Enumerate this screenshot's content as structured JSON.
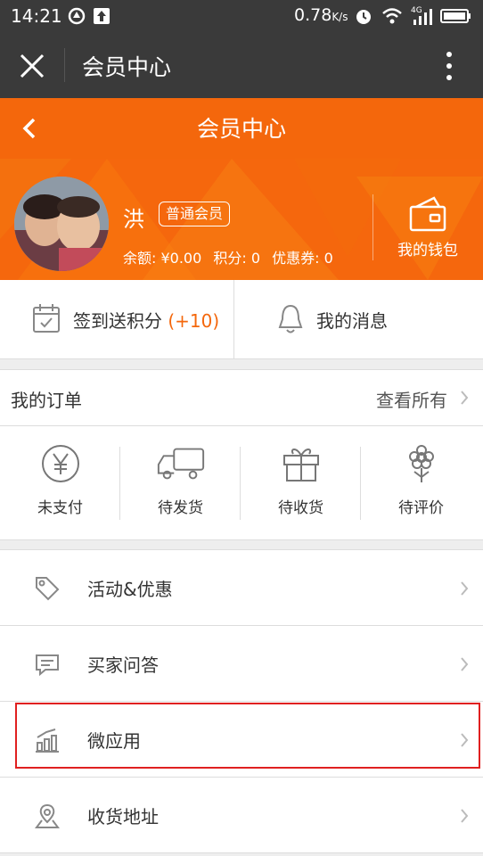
{
  "statusbar": {
    "time": "14:21",
    "speed": "0.78",
    "speed_unit": "K/s",
    "network": "4G"
  },
  "wechat": {
    "title": "会员中心"
  },
  "header": {
    "title": "会员中心"
  },
  "profile": {
    "name": "洪",
    "badge": "普通会员",
    "balance": "余额: ¥0.00",
    "points": "积分: 0",
    "coupons": "优惠券: 0",
    "wallet_label": "我的钱包"
  },
  "checkin": {
    "label": "签到送积分",
    "bonus": "(+10)"
  },
  "messages": {
    "label": "我的消息"
  },
  "orders": {
    "title": "我的订单",
    "view_all": "查看所有",
    "states": [
      "未支付",
      "待发货",
      "待收货",
      "待评价"
    ]
  },
  "menu": [
    {
      "label": "活动&优惠",
      "icon": "tag-icon"
    },
    {
      "label": "买家问答",
      "icon": "chat-icon"
    },
    {
      "label": "微应用",
      "icon": "bar-chart-icon"
    },
    {
      "label": "收货地址",
      "icon": "map-pin-icon"
    }
  ],
  "colors": {
    "accent": "#f4670c",
    "dark_bar": "#3a3a3a",
    "highlight": "#e02020"
  }
}
